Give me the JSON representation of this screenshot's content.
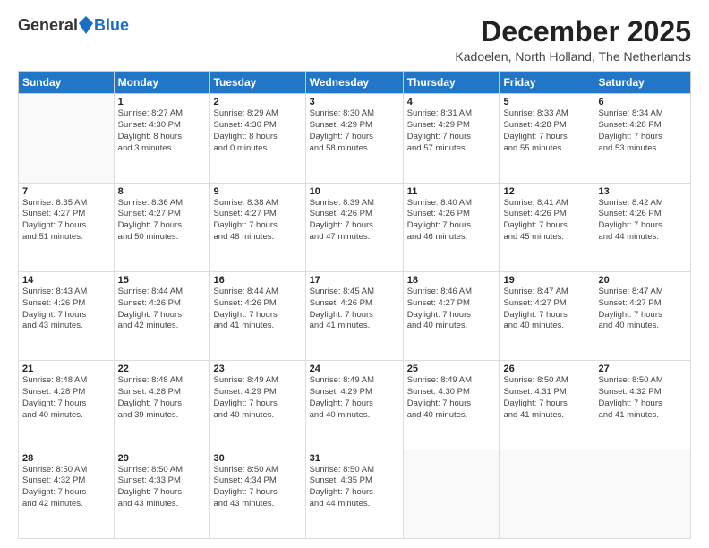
{
  "logo": {
    "general": "General",
    "blue": "Blue"
  },
  "title": "December 2025",
  "location": "Kadoelen, North Holland, The Netherlands",
  "days_of_week": [
    "Sunday",
    "Monday",
    "Tuesday",
    "Wednesday",
    "Thursday",
    "Friday",
    "Saturday"
  ],
  "weeks": [
    [
      {
        "day": "",
        "info": ""
      },
      {
        "day": "1",
        "info": "Sunrise: 8:27 AM\nSunset: 4:30 PM\nDaylight: 8 hours\nand 3 minutes."
      },
      {
        "day": "2",
        "info": "Sunrise: 8:29 AM\nSunset: 4:30 PM\nDaylight: 8 hours\nand 0 minutes."
      },
      {
        "day": "3",
        "info": "Sunrise: 8:30 AM\nSunset: 4:29 PM\nDaylight: 7 hours\nand 58 minutes."
      },
      {
        "day": "4",
        "info": "Sunrise: 8:31 AM\nSunset: 4:29 PM\nDaylight: 7 hours\nand 57 minutes."
      },
      {
        "day": "5",
        "info": "Sunrise: 8:33 AM\nSunset: 4:28 PM\nDaylight: 7 hours\nand 55 minutes."
      },
      {
        "day": "6",
        "info": "Sunrise: 8:34 AM\nSunset: 4:28 PM\nDaylight: 7 hours\nand 53 minutes."
      }
    ],
    [
      {
        "day": "7",
        "info": "Sunrise: 8:35 AM\nSunset: 4:27 PM\nDaylight: 7 hours\nand 51 minutes."
      },
      {
        "day": "8",
        "info": "Sunrise: 8:36 AM\nSunset: 4:27 PM\nDaylight: 7 hours\nand 50 minutes."
      },
      {
        "day": "9",
        "info": "Sunrise: 8:38 AM\nSunset: 4:27 PM\nDaylight: 7 hours\nand 48 minutes."
      },
      {
        "day": "10",
        "info": "Sunrise: 8:39 AM\nSunset: 4:26 PM\nDaylight: 7 hours\nand 47 minutes."
      },
      {
        "day": "11",
        "info": "Sunrise: 8:40 AM\nSunset: 4:26 PM\nDaylight: 7 hours\nand 46 minutes."
      },
      {
        "day": "12",
        "info": "Sunrise: 8:41 AM\nSunset: 4:26 PM\nDaylight: 7 hours\nand 45 minutes."
      },
      {
        "day": "13",
        "info": "Sunrise: 8:42 AM\nSunset: 4:26 PM\nDaylight: 7 hours\nand 44 minutes."
      }
    ],
    [
      {
        "day": "14",
        "info": "Sunrise: 8:43 AM\nSunset: 4:26 PM\nDaylight: 7 hours\nand 43 minutes."
      },
      {
        "day": "15",
        "info": "Sunrise: 8:44 AM\nSunset: 4:26 PM\nDaylight: 7 hours\nand 42 minutes."
      },
      {
        "day": "16",
        "info": "Sunrise: 8:44 AM\nSunset: 4:26 PM\nDaylight: 7 hours\nand 41 minutes."
      },
      {
        "day": "17",
        "info": "Sunrise: 8:45 AM\nSunset: 4:26 PM\nDaylight: 7 hours\nand 41 minutes."
      },
      {
        "day": "18",
        "info": "Sunrise: 8:46 AM\nSunset: 4:27 PM\nDaylight: 7 hours\nand 40 minutes."
      },
      {
        "day": "19",
        "info": "Sunrise: 8:47 AM\nSunset: 4:27 PM\nDaylight: 7 hours\nand 40 minutes."
      },
      {
        "day": "20",
        "info": "Sunrise: 8:47 AM\nSunset: 4:27 PM\nDaylight: 7 hours\nand 40 minutes."
      }
    ],
    [
      {
        "day": "21",
        "info": "Sunrise: 8:48 AM\nSunset: 4:28 PM\nDaylight: 7 hours\nand 40 minutes."
      },
      {
        "day": "22",
        "info": "Sunrise: 8:48 AM\nSunset: 4:28 PM\nDaylight: 7 hours\nand 39 minutes."
      },
      {
        "day": "23",
        "info": "Sunrise: 8:49 AM\nSunset: 4:29 PM\nDaylight: 7 hours\nand 40 minutes."
      },
      {
        "day": "24",
        "info": "Sunrise: 8:49 AM\nSunset: 4:29 PM\nDaylight: 7 hours\nand 40 minutes."
      },
      {
        "day": "25",
        "info": "Sunrise: 8:49 AM\nSunset: 4:30 PM\nDaylight: 7 hours\nand 40 minutes."
      },
      {
        "day": "26",
        "info": "Sunrise: 8:50 AM\nSunset: 4:31 PM\nDaylight: 7 hours\nand 41 minutes."
      },
      {
        "day": "27",
        "info": "Sunrise: 8:50 AM\nSunset: 4:32 PM\nDaylight: 7 hours\nand 41 minutes."
      }
    ],
    [
      {
        "day": "28",
        "info": "Sunrise: 8:50 AM\nSunset: 4:32 PM\nDaylight: 7 hours\nand 42 minutes."
      },
      {
        "day": "29",
        "info": "Sunrise: 8:50 AM\nSunset: 4:33 PM\nDaylight: 7 hours\nand 43 minutes."
      },
      {
        "day": "30",
        "info": "Sunrise: 8:50 AM\nSunset: 4:34 PM\nDaylight: 7 hours\nand 43 minutes."
      },
      {
        "day": "31",
        "info": "Sunrise: 8:50 AM\nSunset: 4:35 PM\nDaylight: 7 hours\nand 44 minutes."
      },
      {
        "day": "",
        "info": ""
      },
      {
        "day": "",
        "info": ""
      },
      {
        "day": "",
        "info": ""
      }
    ]
  ]
}
